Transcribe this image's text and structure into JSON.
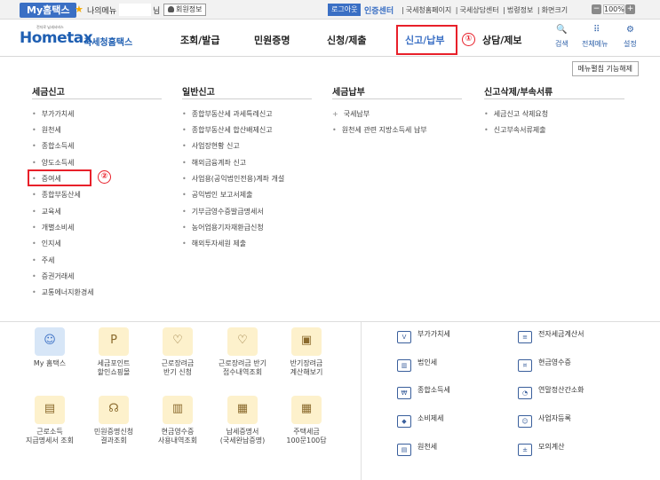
{
  "topbar": {
    "myhome_tab": "My홈택스",
    "my_menu": "나의메뉴",
    "name_suffix": "님",
    "member_info": "회원정보",
    "logout": "로그아웃",
    "cert_center": "인증센터",
    "links": [
      "국세청홈페이지",
      "국세상담센터",
      "법령정보",
      "화면크기"
    ],
    "zoom": "100%"
  },
  "header": {
    "logo_small": "전자로 납세서비스",
    "logo_main": "Hometax",
    "logo_sub": "국세청홈택스",
    "nav": [
      "조회/발급",
      "민원증명",
      "신청/제출",
      "신고/납부",
      "상담/제보"
    ],
    "active_nav": "신고/납부",
    "icons": [
      "검색",
      "전체메뉴",
      "설정"
    ],
    "markers": [
      "①",
      "②"
    ]
  },
  "mega_menu": {
    "unbookmark_btn": "메뉴펼침 기능해제",
    "columns": [
      {
        "title": "세금신고",
        "items": [
          "부가가치세",
          "원천세",
          "종합소득세",
          "양도소득세",
          "증여세",
          "종합부동산세",
          "교육세",
          "개별소비세",
          "인지세",
          "주세",
          "증권거래세",
          "교통에너지환경세"
        ]
      },
      {
        "title": "일반신고",
        "items": [
          "종합부동산세 과세특례신고",
          "종합부동산세 합산배제신고",
          "사업장현황 신고",
          "해외금융계좌 신고",
          "사업용(공익법인전용)계좌 개설",
          "공익법인 보고서제출",
          "기부금영수증발급명세서",
          "농어업용기자재환급신청",
          "해외투자세원 제출"
        ]
      },
      {
        "title": "세금납부",
        "items": [
          "국세납부",
          "원천세 관련 지방소득세 납부"
        ]
      },
      {
        "title": "신고삭제/부속서류",
        "items": [
          "세금신고 삭제요청",
          "신고부속서류제출"
        ]
      }
    ]
  },
  "tiles": [
    {
      "label": "My 홈택스",
      "icon": "person-icon"
    },
    {
      "label": "세금포인트\n할인쇼핑몰",
      "icon": "point-icon"
    },
    {
      "label": "근로장려금\n반기 신청",
      "icon": "heart-hand-icon"
    },
    {
      "label": "근로장려금 반기\n접수내역조회",
      "icon": "heart-check-icon"
    },
    {
      "label": "반기장려금\n계산해보기",
      "icon": "calculator-icon"
    },
    {
      "label": "근로소득\n지급명세서 조회",
      "icon": "money-icon"
    },
    {
      "label": "민원증명신청\n결과조회",
      "icon": "headset-icon"
    },
    {
      "label": "현금영수증\n사용내역조회",
      "icon": "receipt-icon"
    },
    {
      "label": "납세증명서\n(국세완납증명)",
      "icon": "document-icon"
    },
    {
      "label": "주택세금\n100문100답",
      "icon": "building-icon"
    }
  ],
  "quick_links": [
    {
      "label": "부가가치세",
      "icon": "vat-icon"
    },
    {
      "label": "전자세금계산서",
      "icon": "invoice-icon"
    },
    {
      "label": "법인세",
      "icon": "corporate-icon"
    },
    {
      "label": "현금영수증",
      "icon": "cash-receipt-icon"
    },
    {
      "label": "종합소득세",
      "icon": "income-icon"
    },
    {
      "label": "연말정산간소화",
      "icon": "year-end-icon"
    },
    {
      "label": "소비제세",
      "icon": "diamond-icon"
    },
    {
      "label": "사업자등록",
      "icon": "business-icon"
    },
    {
      "label": "원천세",
      "icon": "withholding-icon"
    },
    {
      "label": "모의계산",
      "icon": "simulation-icon"
    }
  ]
}
